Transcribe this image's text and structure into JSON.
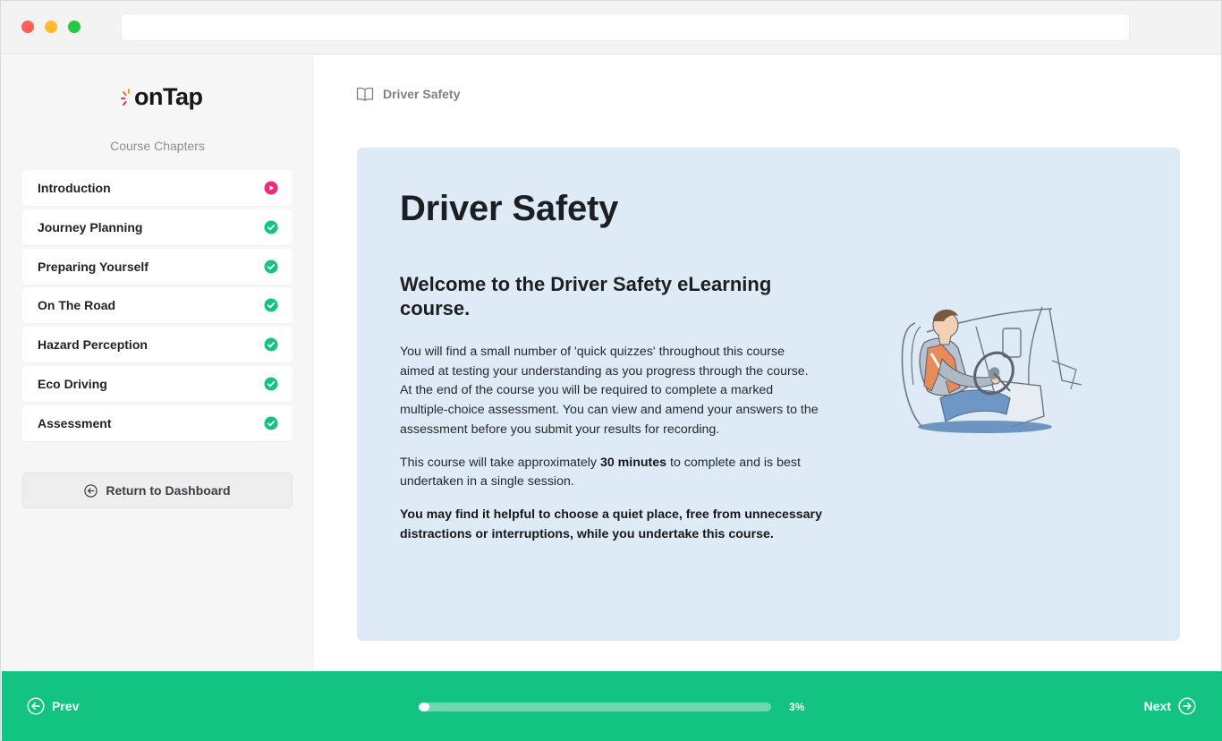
{
  "colors": {
    "accent_green": "#12c382",
    "playing_pink": "#ee2a7b",
    "complete_green": "#12c382",
    "card_bg": "#deebf7"
  },
  "logo": {
    "text": "onTap"
  },
  "sidebar": {
    "heading": "Course Chapters",
    "items": [
      {
        "label": "Introduction",
        "status": "current",
        "icon": "play-circle-icon"
      },
      {
        "label": "Journey Planning",
        "status": "complete",
        "icon": "check-circle-icon"
      },
      {
        "label": "Preparing Yourself",
        "status": "complete",
        "icon": "check-circle-icon"
      },
      {
        "label": "On The Road",
        "status": "complete",
        "icon": "check-circle-icon"
      },
      {
        "label": "Hazard Perception",
        "status": "complete",
        "icon": "check-circle-icon"
      },
      {
        "label": "Eco Driving",
        "status": "complete",
        "icon": "check-circle-icon"
      },
      {
        "label": "Assessment",
        "status": "complete",
        "icon": "check-circle-icon"
      }
    ],
    "dashboard_button": {
      "label": "Return to Dashboard",
      "icon": "arrow-left-circle-icon"
    }
  },
  "main": {
    "breadcrumb": {
      "icon": "book-icon",
      "label": "Driver Safety"
    },
    "card": {
      "title": "Driver Safety",
      "subtitle": "Welcome to the Driver Safety eLearning course.",
      "para1": "You will find a small number of 'quick quizzes' throughout this course aimed at testing your understanding as you progress through the course.  At the end of the course you will be required to complete a marked multiple-choice assessment. You can view and amend your answers to the assessment before you submit your results for recording.",
      "para2_before": "This course will take approximately ",
      "para2_bold": "30 minutes",
      "para2_after": " to complete and is best undertaken in a single session.",
      "para3": "You may find it helpful to choose a quiet place, free from unnecessary distractions or interruptions, while you undertake this course.",
      "illustration": "truck-driver-illustration"
    }
  },
  "footer": {
    "prev_label": "Prev",
    "next_label": "Next",
    "progress_percent": 3,
    "progress_label": "3%"
  }
}
